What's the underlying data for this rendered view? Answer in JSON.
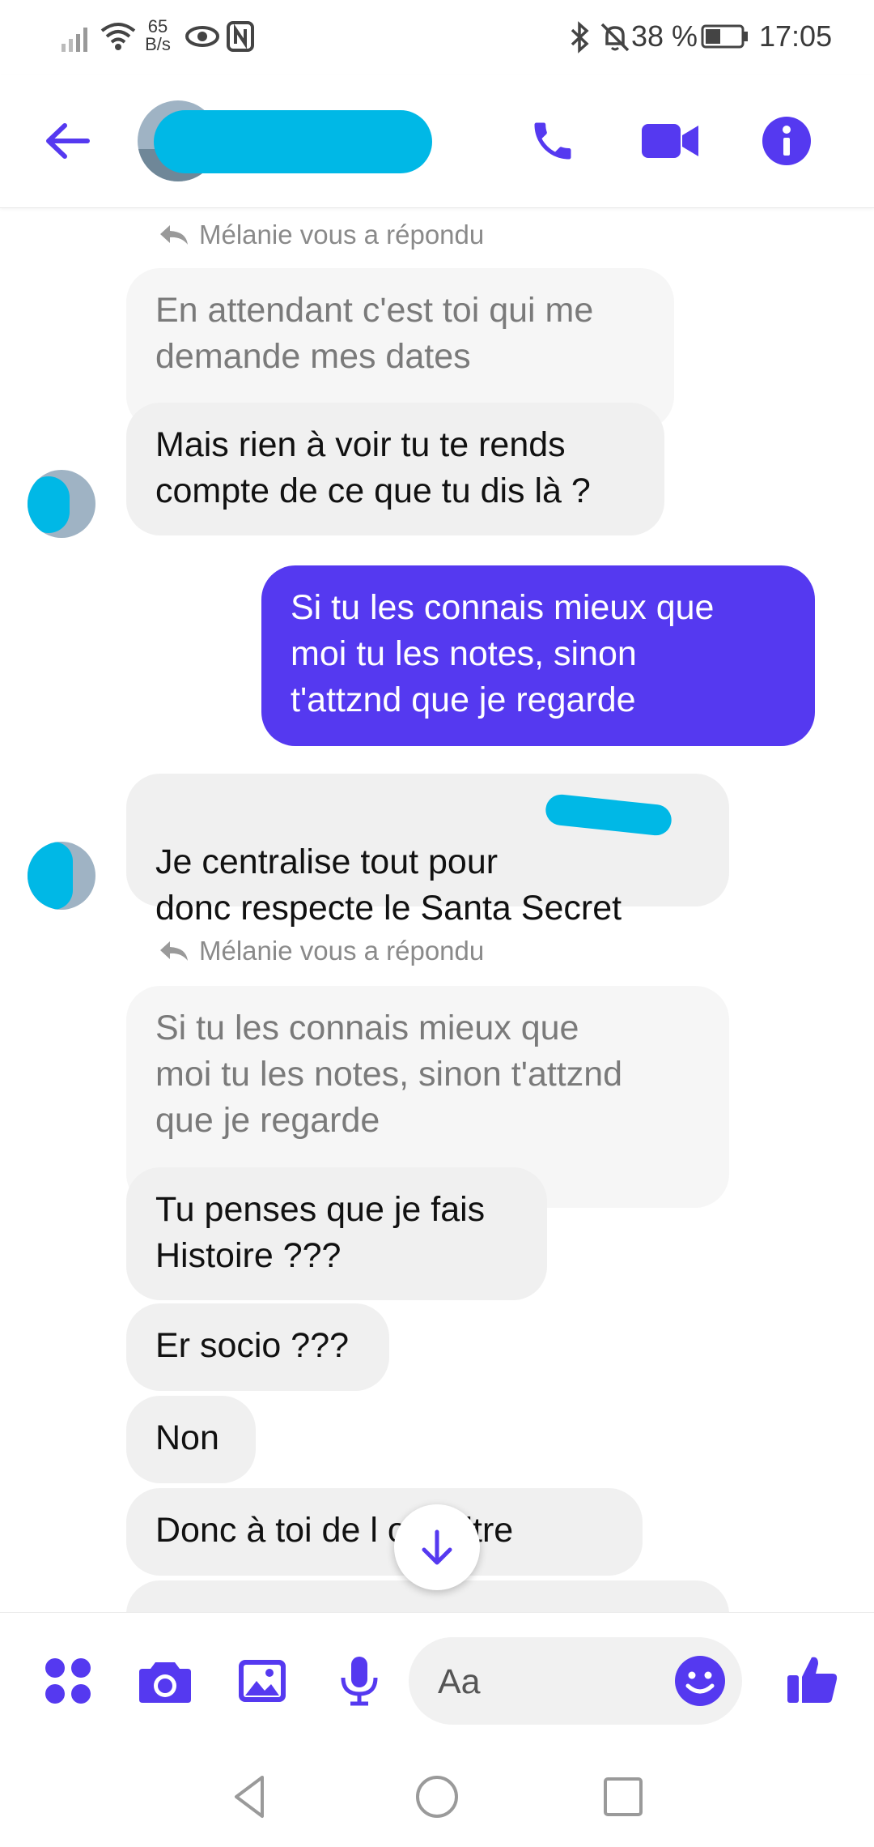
{
  "status_bar": {
    "net_speed_value": "65",
    "net_speed_unit": "B/s",
    "battery": "38 %",
    "time": "17:05"
  },
  "header": {
    "back_icon": "arrow-left-icon",
    "contact_name": "",
    "call_icon": "phone-icon",
    "video_icon": "video-camera-icon",
    "info_icon": "info-icon"
  },
  "messages": [
    {
      "type": "reply_note",
      "text": "Mélanie vous a répondu"
    },
    {
      "type": "quoted",
      "text": "En attendant c'est toi qui me\ndemande mes dates"
    },
    {
      "type": "received",
      "text": "Mais rien à voir  tu te rends\ncompte de ce que tu dis là ?"
    },
    {
      "type": "sent",
      "text": "Si tu les connais mieux que\nmoi tu les notes, sinon\nt'attznd que je regarde"
    },
    {
      "type": "received",
      "text": "Je centralise tout pour\ndonc respecte le Santa Secret"
    },
    {
      "type": "reply_note",
      "text": "Mélanie vous a répondu"
    },
    {
      "type": "quoted",
      "text": "Si tu les connais mieux que\nmoi tu les notes, sinon t'attznd\nque je regarde"
    },
    {
      "type": "received",
      "text": "Tu penses que je fais\nHistoire ???"
    },
    {
      "type": "received",
      "text": "Er socio ???"
    },
    {
      "type": "received",
      "text": "Non"
    },
    {
      "type": "received",
      "text": "Donc à toi de l        onnaitre"
    }
  ],
  "scroll_down_icon": "arrow-down-icon",
  "composer": {
    "menu_icon": "four-dots-icon",
    "camera_icon": "camera-icon",
    "gallery_icon": "image-icon",
    "mic_icon": "microphone-icon",
    "placeholder": "Aa",
    "emoji_icon": "smiley-icon",
    "like_icon": "thumbs-up-icon"
  },
  "nav": {
    "back_icon": "triangle-back-icon",
    "home_icon": "circle-home-icon",
    "recents_icon": "square-recents-icon"
  },
  "colors": {
    "accent": "#5539f0",
    "redaction": "#00b8e6"
  }
}
